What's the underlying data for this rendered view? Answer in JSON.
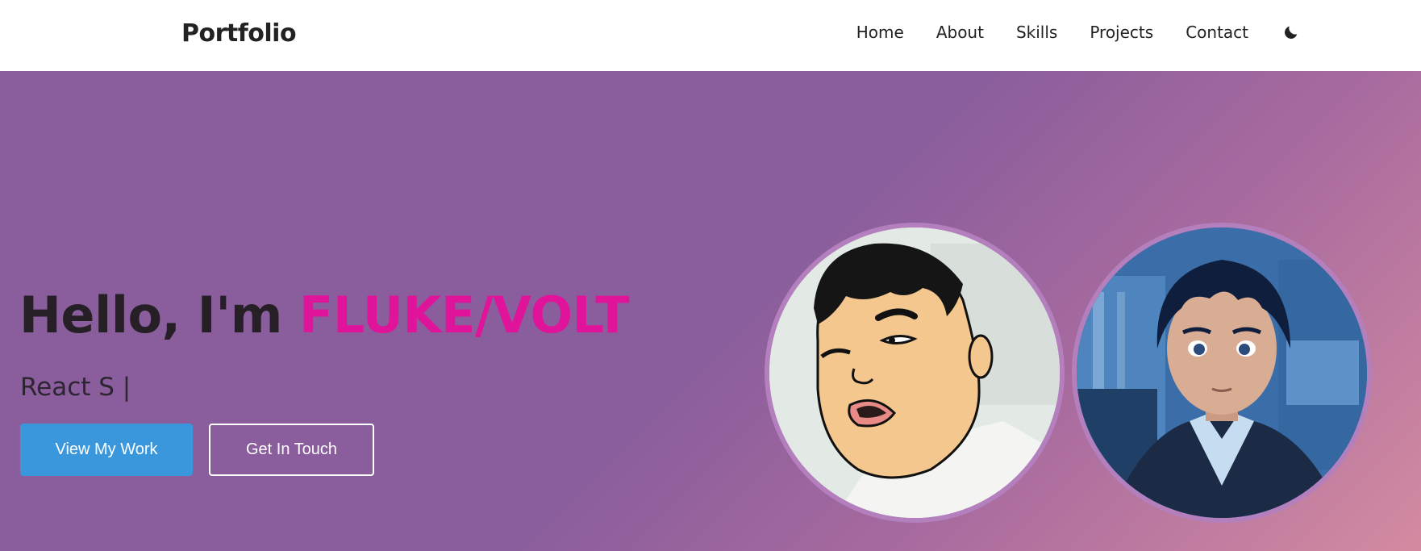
{
  "navbar": {
    "brand": "Portfolio",
    "links": [
      "Home",
      "About",
      "Skills",
      "Projects",
      "Contact"
    ],
    "theme_icon": "moon-icon"
  },
  "hero": {
    "greeting": "Hello, I'm ",
    "name": "FLUKE/VOLT",
    "typing_text": "React S |",
    "primary_button": "View My Work",
    "secondary_button": "Get In Touch",
    "avatars": [
      "cartoon-avatar-left",
      "anime-avatar-right"
    ]
  },
  "colors": {
    "accent_name": "#e0149a",
    "primary_button": "#3a97dc",
    "hero_bg": "#8a5e9c",
    "hero_bg_end": "#d38ba0"
  }
}
